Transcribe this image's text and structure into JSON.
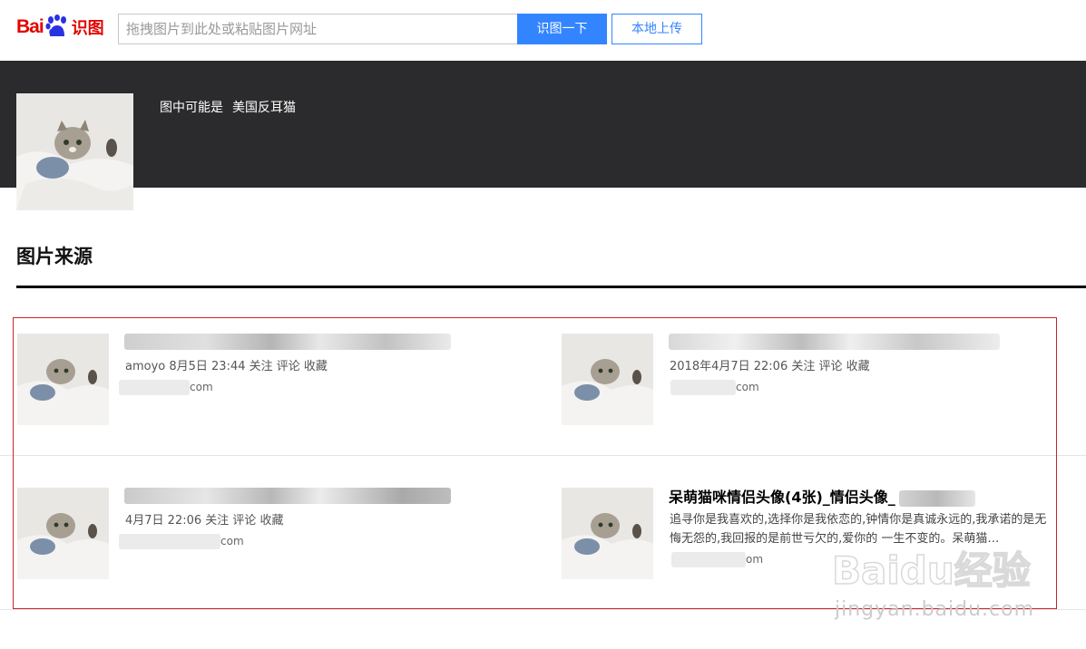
{
  "header": {
    "logo_bai": "Bai",
    "logo_du": "du",
    "logo_product": "识图",
    "search_placeholder": "拖拽图片到此处或粘贴图片网址",
    "search_button": "识图一下",
    "upload_button": "本地上传"
  },
  "banner": {
    "guess_label": "图中可能是",
    "guess_result": "美国反耳猫"
  },
  "section": {
    "title": "图片来源"
  },
  "results": [
    {
      "title": "",
      "meta": "amoyo 8月5日 23:44 关注 评论 收藏",
      "domain_suffix": "com",
      "description": ""
    },
    {
      "title": "",
      "meta": "2018年4月7日 22:06 关注 评论 收藏",
      "domain_suffix": "com",
      "description": ""
    },
    {
      "title": "",
      "meta": "4月7日 22:06 关注 评论 收藏",
      "domain_suffix": "com",
      "description": ""
    },
    {
      "title": "呆萌猫咪情侣头像(4张)_情侣头像_",
      "meta": "",
      "domain_suffix": "om",
      "description": "追寻你是我喜欢的,选择你是我依恋的,钟情你是真诚永远的,我承诺的是无悔无怨的,我回报的是前世亏欠的,爱你的 一生不变的。呆萌猫…"
    }
  ],
  "watermark": {
    "brand": "Baidu经验",
    "url": "jingyan.baidu.com"
  },
  "colors": {
    "accent": "#3385ff",
    "logo_red": "#e10601",
    "logo_blue": "#2932e1",
    "banner_bg": "#2b2b2d",
    "highlight_border": "#c9242b"
  }
}
